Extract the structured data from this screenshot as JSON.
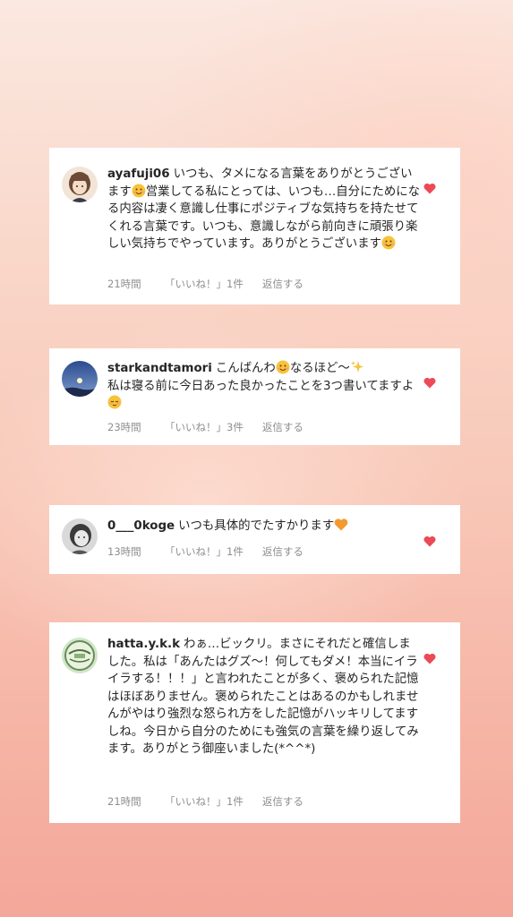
{
  "comments": [
    {
      "username": "ayafuji06",
      "text": "いつも、タメになる言葉をありがとうございます😊営業してる私にとっては、いつも…自分にためになる内容は凄く意識し仕事にポジティブな気持ちを持たせてくれる言葉です。いつも、意識しながら前向きに頑張り楽しい気持ちでやっています。ありがとうございます😊",
      "segments": [
        "いつも、タメになる言葉をありがとうございます",
        "営業してる私にとっては、いつも…自分にためになる内容は凄く意識し仕事にポジティブな気持ちを持たせてくれる言葉です。",
        "いつも、意識しながら前向きに頑張り楽しい気持ちでやっています。ありがとうございます"
      ],
      "time": "21時間",
      "likes": "「いいね！」1件",
      "reply": "返信する"
    },
    {
      "username": "starkandtamori",
      "segments": [
        "こんばんわ",
        "なるほど〜",
        "私は寝る前に今日あった良かったことを3つ書いてますよ"
      ],
      "time": "23時間",
      "likes": "「いいね！」3件",
      "reply": "返信する"
    },
    {
      "username": "0___0koge",
      "segments": [
        "いつも具体的でたすかります"
      ],
      "time": "13時間",
      "likes": "「いいね！」1件",
      "reply": "返信する"
    },
    {
      "username": "hatta.y.k.k",
      "segments": [
        "わぁ…ビックリ。まさにそれだと確信しました。私は「あんたはグズ〜！何してもダメ！本当にイライラする！！！」と言われたことが多く、褒められた記憶はほぼありません。褒められたことはあるのかもしれませんがやはり強烈な怒られ方をした記憶がハッキリしてますしね。今日から自分のためにも強気の言葉を繰り返してみます。ありがとう御座いました(*^^*)"
      ],
      "time": "21時間",
      "likes": "「いいね！」1件",
      "reply": "返信する"
    }
  ],
  "colors": {
    "heart": "#ed4956",
    "meta": "#8e8e8e",
    "text": "#262626"
  }
}
